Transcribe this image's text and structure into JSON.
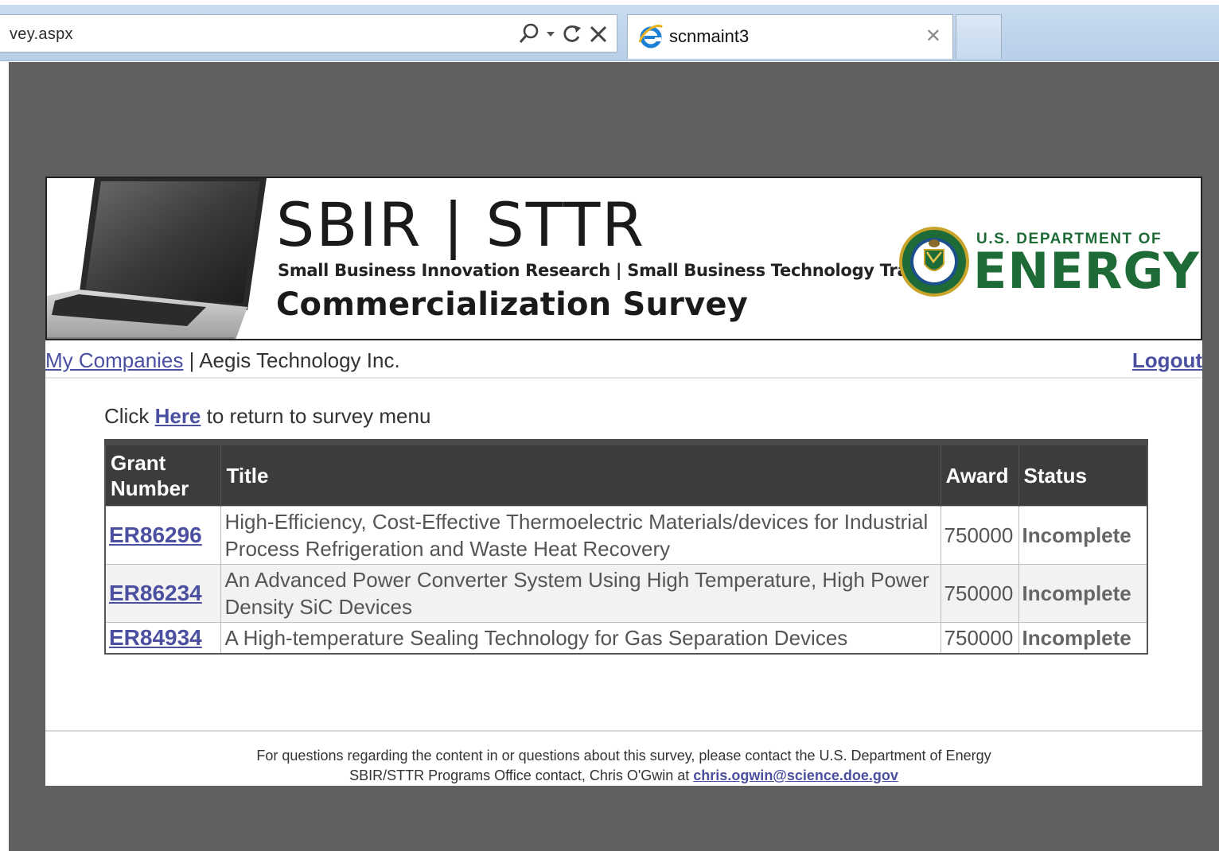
{
  "browser": {
    "address_text": "vey.aspx",
    "tab_title": "scnmaint3"
  },
  "header": {
    "brand_title": "SBIR | STTR",
    "brand_subtitle": "Small Business Innovation Research | Small Business Technology Transfer",
    "survey_title": "Commercialization Survey",
    "doe_top": "U.S. DEPARTMENT OF",
    "doe_energy": "ENERGY",
    "brand_color": "#1f6b37"
  },
  "nav": {
    "my_companies": "My Companies",
    "separator": "|",
    "company_name": "Aegis Technology Inc.",
    "logout": "Logout"
  },
  "return_line": {
    "prefix": "Click",
    "link": "Here",
    "suffix": "to return to survey menu"
  },
  "table": {
    "headers": {
      "grant_number": "Grant Number",
      "title": "Title",
      "award": "Award",
      "status": "Status"
    },
    "rows": [
      {
        "grant": "ER86296",
        "title": "High-Efficiency, Cost-Effective Thermoelectric Materials/devices for Industrial Process Refrigeration and Waste Heat Recovery",
        "award": "750000",
        "status": "Incomplete"
      },
      {
        "grant": "ER86234",
        "title": "An Advanced Power Converter System Using High Temperature, High Power Density SiC Devices",
        "award": "750000",
        "status": "Incomplete"
      },
      {
        "grant": "ER84934",
        "title": "A High-temperature Sealing Technology for Gas Separation Devices",
        "award": "750000",
        "status": "Incomplete"
      }
    ]
  },
  "footer": {
    "line1": "For questions regarding the content in or questions about this survey, please contact the U.S. Department of Energy",
    "line2_prefix": "SBIR/STTR Programs Office contact, Chris O'Gwin at",
    "email": "chris.ogwin@science.doe.gov"
  }
}
